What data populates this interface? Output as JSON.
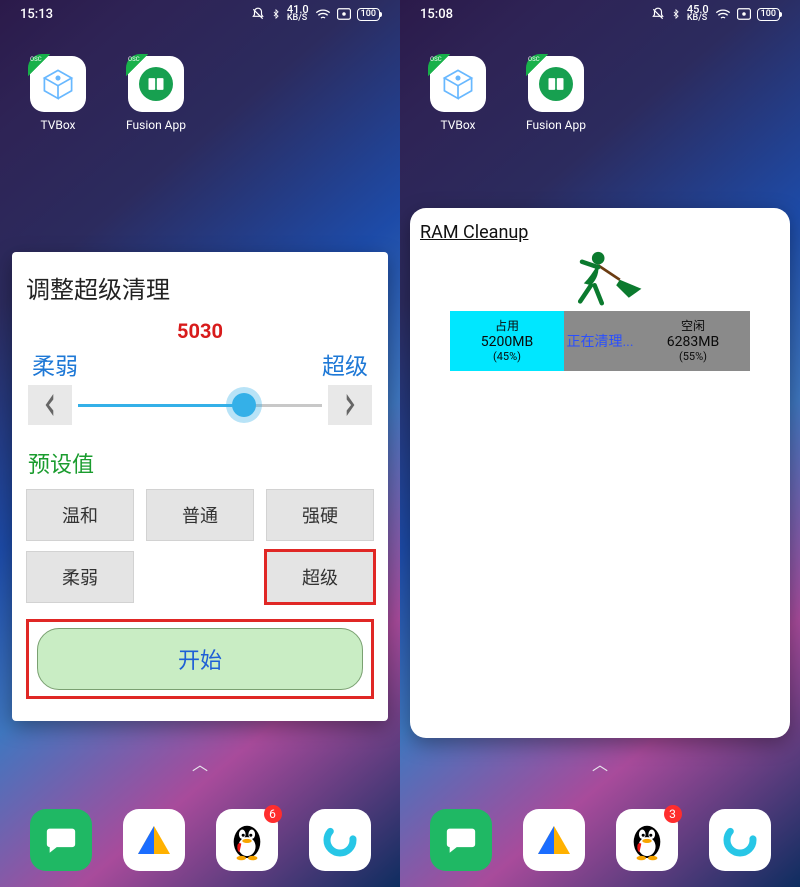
{
  "left": {
    "status": {
      "time": "15:13",
      "net_speed": "41.0",
      "net_unit": "KB/S",
      "battery": "100"
    },
    "apps": [
      {
        "name": "TVBox"
      },
      {
        "name": "Fusion App"
      }
    ],
    "dialog": {
      "title": "调整超级清理",
      "readout": "5030",
      "min_label": "柔弱",
      "max_label": "超级",
      "slider_pct": 68,
      "presets_label": "预设值",
      "presets": [
        "温和",
        "普通",
        "强硬",
        "柔弱",
        "",
        "超级"
      ],
      "selected_preset_index": 5,
      "start_label": "开始"
    },
    "dock": {
      "qq_badge": "6"
    }
  },
  "right": {
    "status": {
      "time": "15:08",
      "net_speed": "45.0",
      "net_unit": "KB/S",
      "battery": "100"
    },
    "apps": [
      {
        "name": "TVBox"
      },
      {
        "name": "Fusion App"
      }
    ],
    "card": {
      "title": "RAM Cleanup",
      "used_label": "占用",
      "used_value": "5200MB",
      "used_pct": "(45%)",
      "mid_text": "正在清理...",
      "free_label": "空闲",
      "free_value": "6283MB",
      "free_pct": "(55%)"
    },
    "dock": {
      "qq_badge": "3"
    }
  }
}
